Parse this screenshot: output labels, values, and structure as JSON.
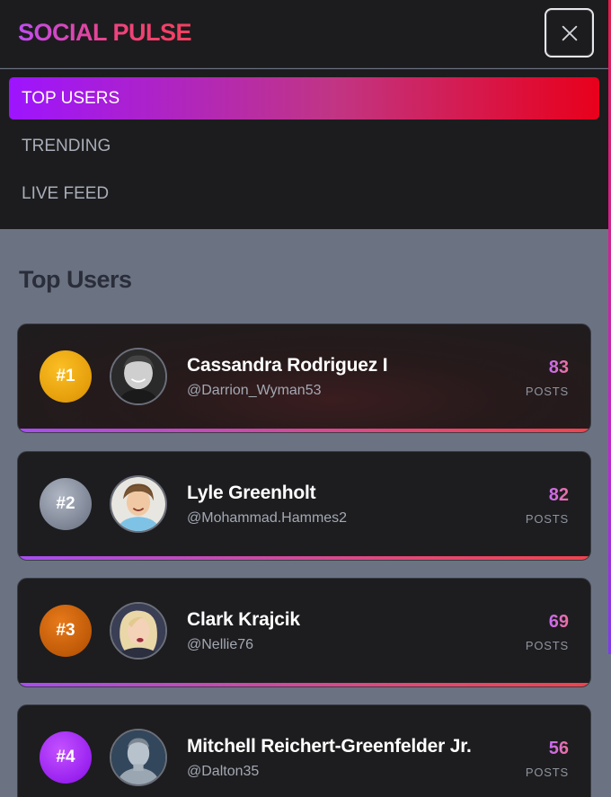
{
  "app": {
    "title": "SOCIAL PULSE"
  },
  "nav": {
    "items": [
      {
        "label": "TOP USERS",
        "active": true
      },
      {
        "label": "TRENDING",
        "active": false
      },
      {
        "label": "LIVE FEED",
        "active": false
      }
    ]
  },
  "main": {
    "title": "Top Users",
    "users": [
      {
        "rank": "#1",
        "name": "Cassandra Rodriguez I",
        "handle": "@Darrion_Wyman53",
        "posts": "83",
        "posts_label": "POSTS"
      },
      {
        "rank": "#2",
        "name": "Lyle Greenholt",
        "handle": "@Mohammad.Hammes2",
        "posts": "82",
        "posts_label": "POSTS"
      },
      {
        "rank": "#3",
        "name": "Clark Krajcik",
        "handle": "@Nellie76",
        "posts": "69",
        "posts_label": "POSTS"
      },
      {
        "rank": "#4",
        "name": "Mitchell Reichert-Greenfelder Jr.",
        "handle": "@Dalton35",
        "posts": "56",
        "posts_label": "POSTS"
      }
    ]
  },
  "icons": {
    "close": "close-icon"
  },
  "colors": {
    "accent_start": "#9d14ff",
    "accent_end": "#e8001b",
    "rank_gold": "#f5a60b",
    "rank_silver": "#8a92a2",
    "rank_bronze": "#c05a08",
    "rank_purple": "#9a22f0"
  }
}
